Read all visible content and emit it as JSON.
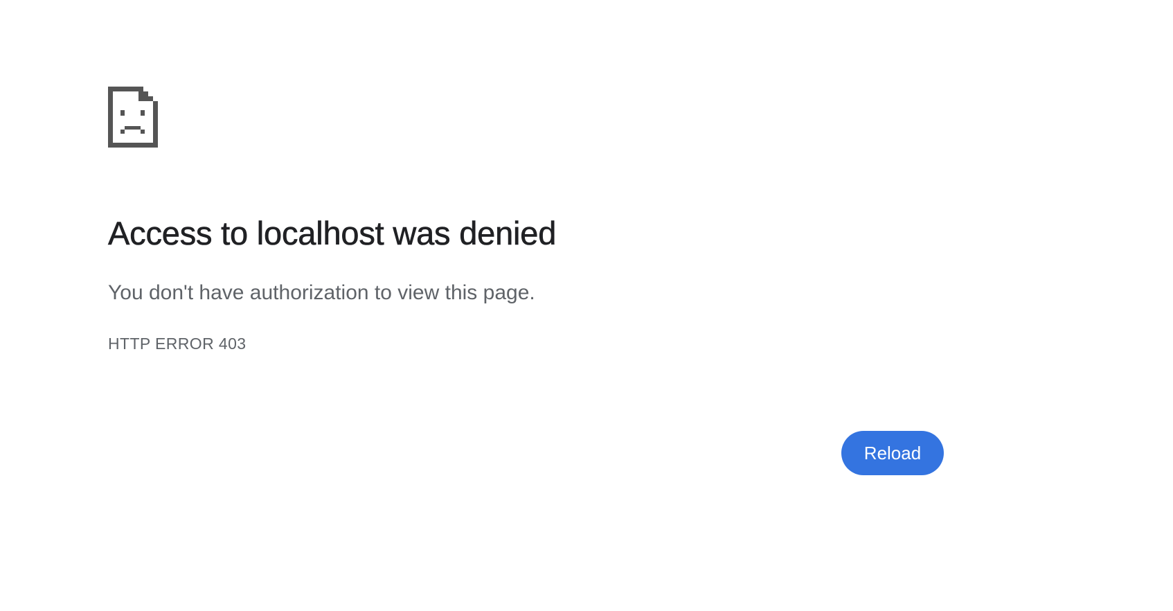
{
  "error_page": {
    "icon": "sad-document-icon",
    "title": "Access to localhost was denied",
    "description": "You don't have authorization to view this page.",
    "error_code": "HTTP ERROR 403",
    "reload_label": "Reload"
  },
  "colors": {
    "background": "#ffffff",
    "title": "#202124",
    "secondary_text": "#5f6368",
    "icon": "#555555",
    "button_background": "#3474e0",
    "button_text": "#ffffff"
  }
}
